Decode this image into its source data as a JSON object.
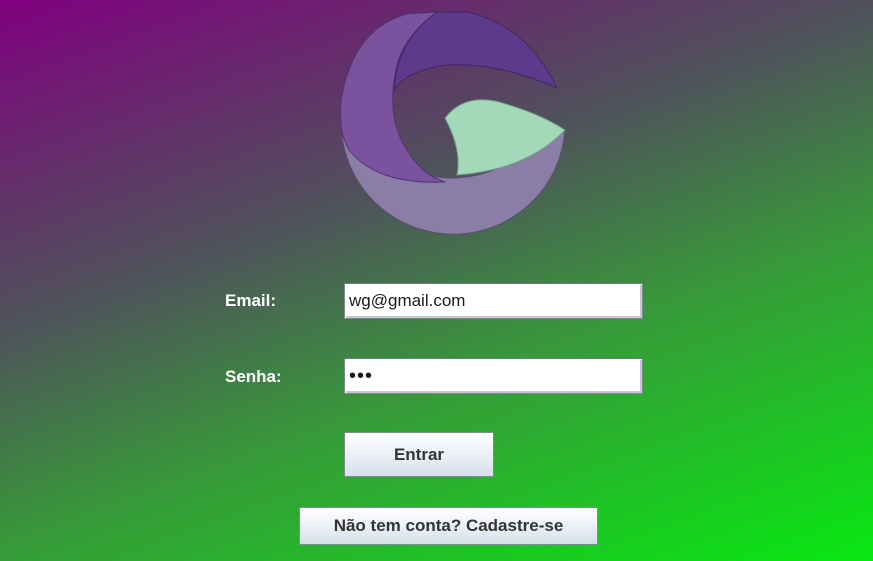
{
  "logo": {
    "icon": "g-logo-icon",
    "colors": {
      "purple_dark": "#5e3a8c",
      "purple_mid": "#7a529e",
      "lavender": "#8a7ea6",
      "mint": "#a3d8b8"
    }
  },
  "form": {
    "email_label": "Email:",
    "email_value": "wg@gmail.com",
    "password_label": "Senha:",
    "password_value": "•••",
    "submit_label": "Entrar",
    "signup_label": "Não tem conta? Cadastre-se"
  },
  "colors": {
    "gradient_start": "#800080",
    "gradient_end": "#08e812",
    "label_text": "#ffffff",
    "button_text": "#333333"
  }
}
